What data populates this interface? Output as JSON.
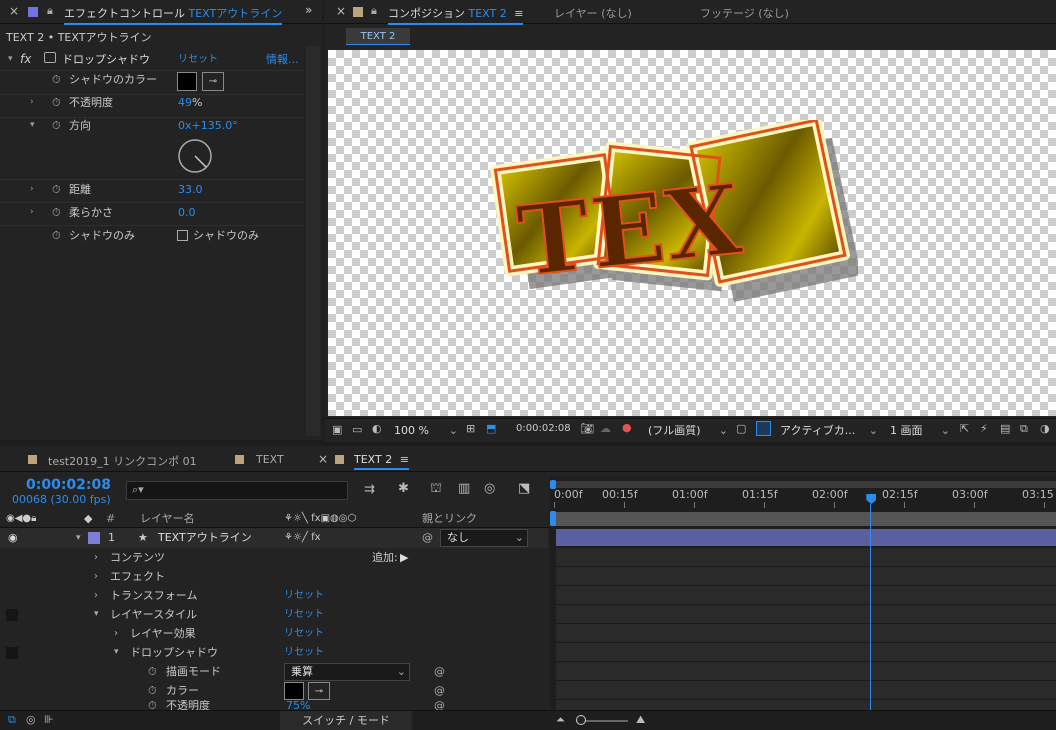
{
  "effect_panel": {
    "tab_close": "×",
    "tab_title": "エフェクトコントロール",
    "tab_layer": "TEXTアウトライン",
    "breadcrumb": "TEXT 2 • TEXTアウトライン",
    "fx_label": "fx",
    "effect_name": "ドロップシャドウ",
    "reset": "リセット",
    "info": "情報...",
    "props": [
      {
        "label": "シャドウのカラー"
      },
      {
        "label": "不透明度",
        "value": "49",
        "unit": "%"
      },
      {
        "label": "方向",
        "value": "0x+135.0°"
      },
      {
        "label": "距離",
        "value": "33.0"
      },
      {
        "label": "柔らかさ",
        "value": "0.0"
      },
      {
        "label": "シャドウのみ",
        "checkbox": "シャドウのみ"
      }
    ]
  },
  "comp_panel": {
    "tab_title": "コンポジション",
    "tab_name": "TEXT 2",
    "layer_tab": "レイヤー (なし)",
    "footage_tab": "フッテージ (なし)",
    "subtab": "TEXT 2",
    "art_text": "TEX",
    "zoom": "100 %",
    "timecode": "0:00:02:08",
    "quality": "(フル画質)",
    "camera": "アクティブカ...",
    "views": "1 画面"
  },
  "timeline": {
    "tabs": [
      "test2019_1 リンクコンポ 01",
      "TEXT",
      "TEXT 2"
    ],
    "timecode": "0:00:02:08",
    "frames": "00068 (30.00 fps)",
    "search_placeholder": "",
    "col_layer_name": "レイヤー名",
    "col_parent": "親とリンク",
    "col_hash": "#",
    "layer_num": "1",
    "layer_name": "TEXTアウトライン",
    "parent_value": "なし",
    "add_label": "追加:",
    "rows": [
      {
        "label": "コンテンツ",
        "reset": ""
      },
      {
        "label": "エフェクト",
        "reset": ""
      },
      {
        "label": "トランスフォーム",
        "reset": "リセット"
      },
      {
        "label": "レイヤースタイル",
        "reset": "リセット"
      },
      {
        "label": "レイヤー効果",
        "reset": "リセット"
      },
      {
        "label": "ドロップシャドウ",
        "reset": "リセット"
      },
      {
        "label": "描画モード",
        "value": "乗算"
      },
      {
        "label": "カラー"
      },
      {
        "label": "不透明度",
        "value": "75%"
      }
    ],
    "ruler": [
      "0:00f",
      "00:15f",
      "01:00f",
      "01:15f",
      "02:00f",
      "02:15f",
      "03:00f",
      "03:15"
    ],
    "current_time_position": 2.2667,
    "switch_mode": "スイッチ / モード",
    "colors": {
      "accent": "#2d8ceb",
      "layer_bar": "#5a5fa0",
      "label": "#7b7fd8"
    }
  }
}
